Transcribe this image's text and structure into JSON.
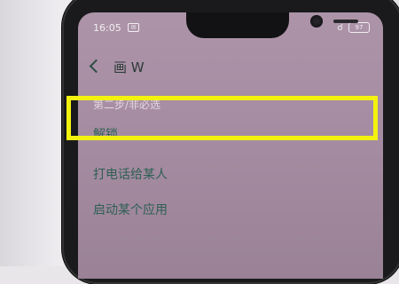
{
  "status_bar": {
    "time": "16:05",
    "mail_icon_text": "✉",
    "battery": "97"
  },
  "header": {
    "title": "画 W"
  },
  "section": {
    "caption": "第二步/非必选"
  },
  "list": {
    "items": [
      {
        "label": "解锁"
      },
      {
        "label": "打电话给某人"
      },
      {
        "label": "启动某个应用"
      }
    ]
  },
  "colors": {
    "screen_bg": "#a78da3",
    "item_text": "#2e5f54",
    "highlight": "#f3f20f"
  }
}
